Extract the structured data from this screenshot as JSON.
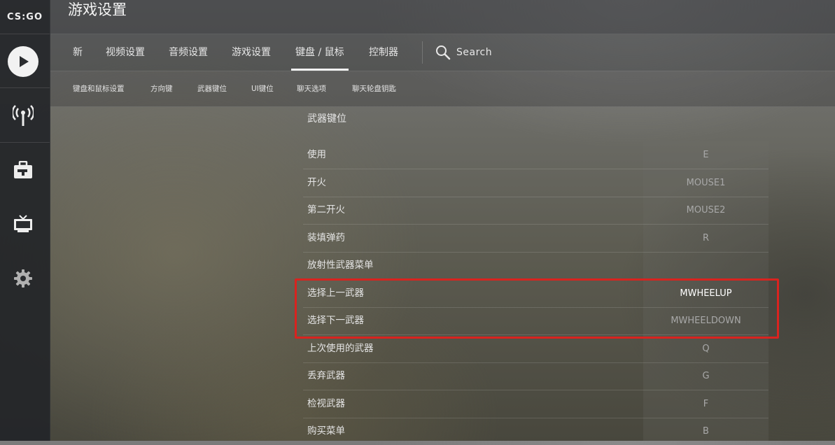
{
  "app": {
    "logo_text": "CS:GO"
  },
  "header": {
    "title": "游戏设置"
  },
  "tabs": [
    {
      "label": "新"
    },
    {
      "label": "视频设置"
    },
    {
      "label": "音频设置"
    },
    {
      "label": "游戏设置"
    },
    {
      "label": "键盘 / 鼠标",
      "active": true
    },
    {
      "label": "控制器"
    }
  ],
  "search": {
    "label": "Search"
  },
  "subtabs": [
    {
      "label": "键盘和鼠标设置"
    },
    {
      "label": "方向键"
    },
    {
      "label": "武器键位"
    },
    {
      "label": "UI键位"
    },
    {
      "label": "聊天选项"
    },
    {
      "label": "聊天轮盘钥匙"
    }
  ],
  "section": {
    "title": "武器键位"
  },
  "bindings": [
    {
      "action": "使用",
      "key": "E"
    },
    {
      "action": "开火",
      "key": "MOUSE1"
    },
    {
      "action": "第二开火",
      "key": "MOUSE2"
    },
    {
      "action": "装填弹药",
      "key": "R"
    },
    {
      "action": "放射性武器菜单",
      "key": ""
    },
    {
      "action": "选择上一武器",
      "key": "MWHEELUP"
    },
    {
      "action": "选择下一武器",
      "key": "MWHEELDOWN"
    },
    {
      "action": "上次使用的武器",
      "key": "Q"
    },
    {
      "action": "丢弃武器",
      "key": "G"
    },
    {
      "action": "检视武器",
      "key": "F"
    },
    {
      "action": "购买菜单",
      "key": "B"
    }
  ],
  "sidebar_icons": [
    "play-icon",
    "broadcast-icon",
    "briefcase-icon",
    "tv-icon",
    "gear-icon"
  ],
  "colors": {
    "highlight": "#d9231f",
    "accent": "#f2f2f2"
  }
}
